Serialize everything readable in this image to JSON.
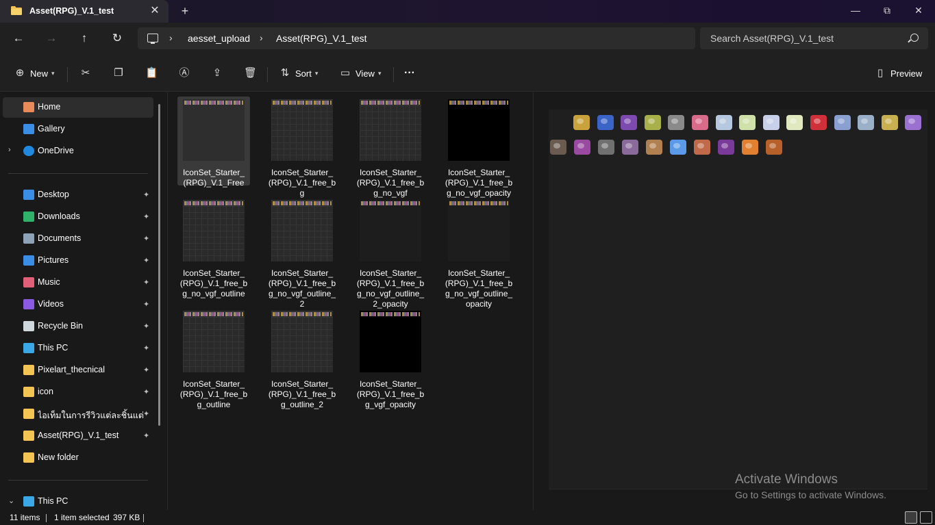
{
  "window": {
    "tab_title": "Asset(RPG)_V.1_test",
    "tab_close": "✕",
    "new_tab": "+",
    "minimize": "—",
    "maximize": "⧉",
    "close": "✕"
  },
  "nav": {
    "back": "←",
    "forward": "→",
    "up": "↑",
    "refresh": "↻",
    "breadcrumb": [
      "aesset_upload",
      "Asset(RPG)_V.1_test"
    ],
    "breadcrumb_sep": "›",
    "search_placeholder": "Search Asset(RPG)_V.1_test"
  },
  "commands": {
    "new": "New",
    "sort": "Sort",
    "view": "View",
    "more": "···",
    "preview": "Preview"
  },
  "sidebar": {
    "home": "Home",
    "gallery": "Gallery",
    "onedrive": "OneDrive",
    "pinned": [
      {
        "label": "Desktop",
        "icon": "desktop-icon",
        "color": "#3a8ee6"
      },
      {
        "label": "Downloads",
        "icon": "download-icon",
        "color": "#2fb36b"
      },
      {
        "label": "Documents",
        "icon": "document-icon",
        "color": "#8ea3b8"
      },
      {
        "label": "Pictures",
        "icon": "pictures-icon",
        "color": "#3a8ee6"
      },
      {
        "label": "Music",
        "icon": "music-icon",
        "color": "#e0607a"
      },
      {
        "label": "Videos",
        "icon": "videos-icon",
        "color": "#8a5ae0"
      },
      {
        "label": "Recycle Bin",
        "icon": "recycle-bin-icon",
        "color": "#cfd8dc"
      },
      {
        "label": "This PC",
        "icon": "this-pc-icon",
        "color": "#3aa8e6"
      },
      {
        "label": "Pixelart_thecnical",
        "icon": "folder-icon",
        "color": "#f3c453"
      },
      {
        "label": "icon",
        "icon": "folder-icon",
        "color": "#f3c453"
      },
      {
        "label": "ไอเท็มในการรีวิวแต่ละชิ้นแต่ละขนาด",
        "icon": "folder-icon",
        "color": "#f3c453"
      },
      {
        "label": "Asset(RPG)_V.1_test",
        "icon": "folder-icon",
        "color": "#f3c453"
      }
    ],
    "new_folder": "New folder",
    "this_pc": "This PC",
    "pin_glyph": "📌"
  },
  "files": [
    {
      "name": "IconSet_Starter_(RPG)_V.1_Free",
      "style": "plain",
      "selected": true
    },
    {
      "name": "IconSet_Starter_(RPG)_V.1_free_bg",
      "style": "grid",
      "selected": false
    },
    {
      "name": "IconSet_Starter_(RPG)_V.1_free_bg_no_vgf",
      "style": "grid",
      "selected": false
    },
    {
      "name": "IconSet_Starter_(RPG)_V.1_free_bg_no_vgf_opacity",
      "style": "black",
      "selected": false
    },
    {
      "name": "IconSet_Starter_(RPG)_V.1_free_bg_no_vgf_outline",
      "style": "grid",
      "selected": false
    },
    {
      "name": "IconSet_Starter_(RPG)_V.1_free_bg_no_vgf_outline_2",
      "style": "grid",
      "selected": false
    },
    {
      "name": "IconSet_Starter_(RPG)_V.1_free_bg_no_vgf_outline_2_opacity",
      "style": "dark",
      "selected": false
    },
    {
      "name": "IconSet_Starter_(RPG)_V.1_free_bg_no_vgf_outline_opacity",
      "style": "dark",
      "selected": false
    },
    {
      "name": "IconSet_Starter_(RPG)_V.1_free_bg_outline",
      "style": "grid",
      "selected": false
    },
    {
      "name": "IconSet_Starter_(RPG)_V.1_free_bg_outline_2",
      "style": "grid",
      "selected": false
    },
    {
      "name": "IconSet_Starter_(RPG)_V.1_free_bg_vgf_opacity",
      "style": "black",
      "selected": false
    }
  ],
  "preview_sprites": {
    "row1": [
      "#c9a23c",
      "#3b64c8",
      "#7d4bb0",
      "#a8b04a",
      "#8a8a8a",
      "#d86a8a",
      "#b6c7e0",
      "#cfe0a8",
      "#c8cfe8",
      "#e0e8c0",
      "#d0303a",
      "#8aa0d0",
      "#9ab0c8",
      "#c8b050",
      "#9a70d0"
    ],
    "row2": [
      "#6a5a50",
      "#9a4aa0",
      "#707070",
      "#8a6a9a",
      "#b08050",
      "#5a9ae8",
      "#c06a4a",
      "#7a3a9a",
      "#e08030",
      "#b8602a"
    ]
  },
  "watermark": {
    "line1": "Activate Windows",
    "line2": "Go to Settings to activate Windows."
  },
  "status": {
    "item_count": "11 items",
    "selection": "1 item selected",
    "size": "397 KB"
  }
}
